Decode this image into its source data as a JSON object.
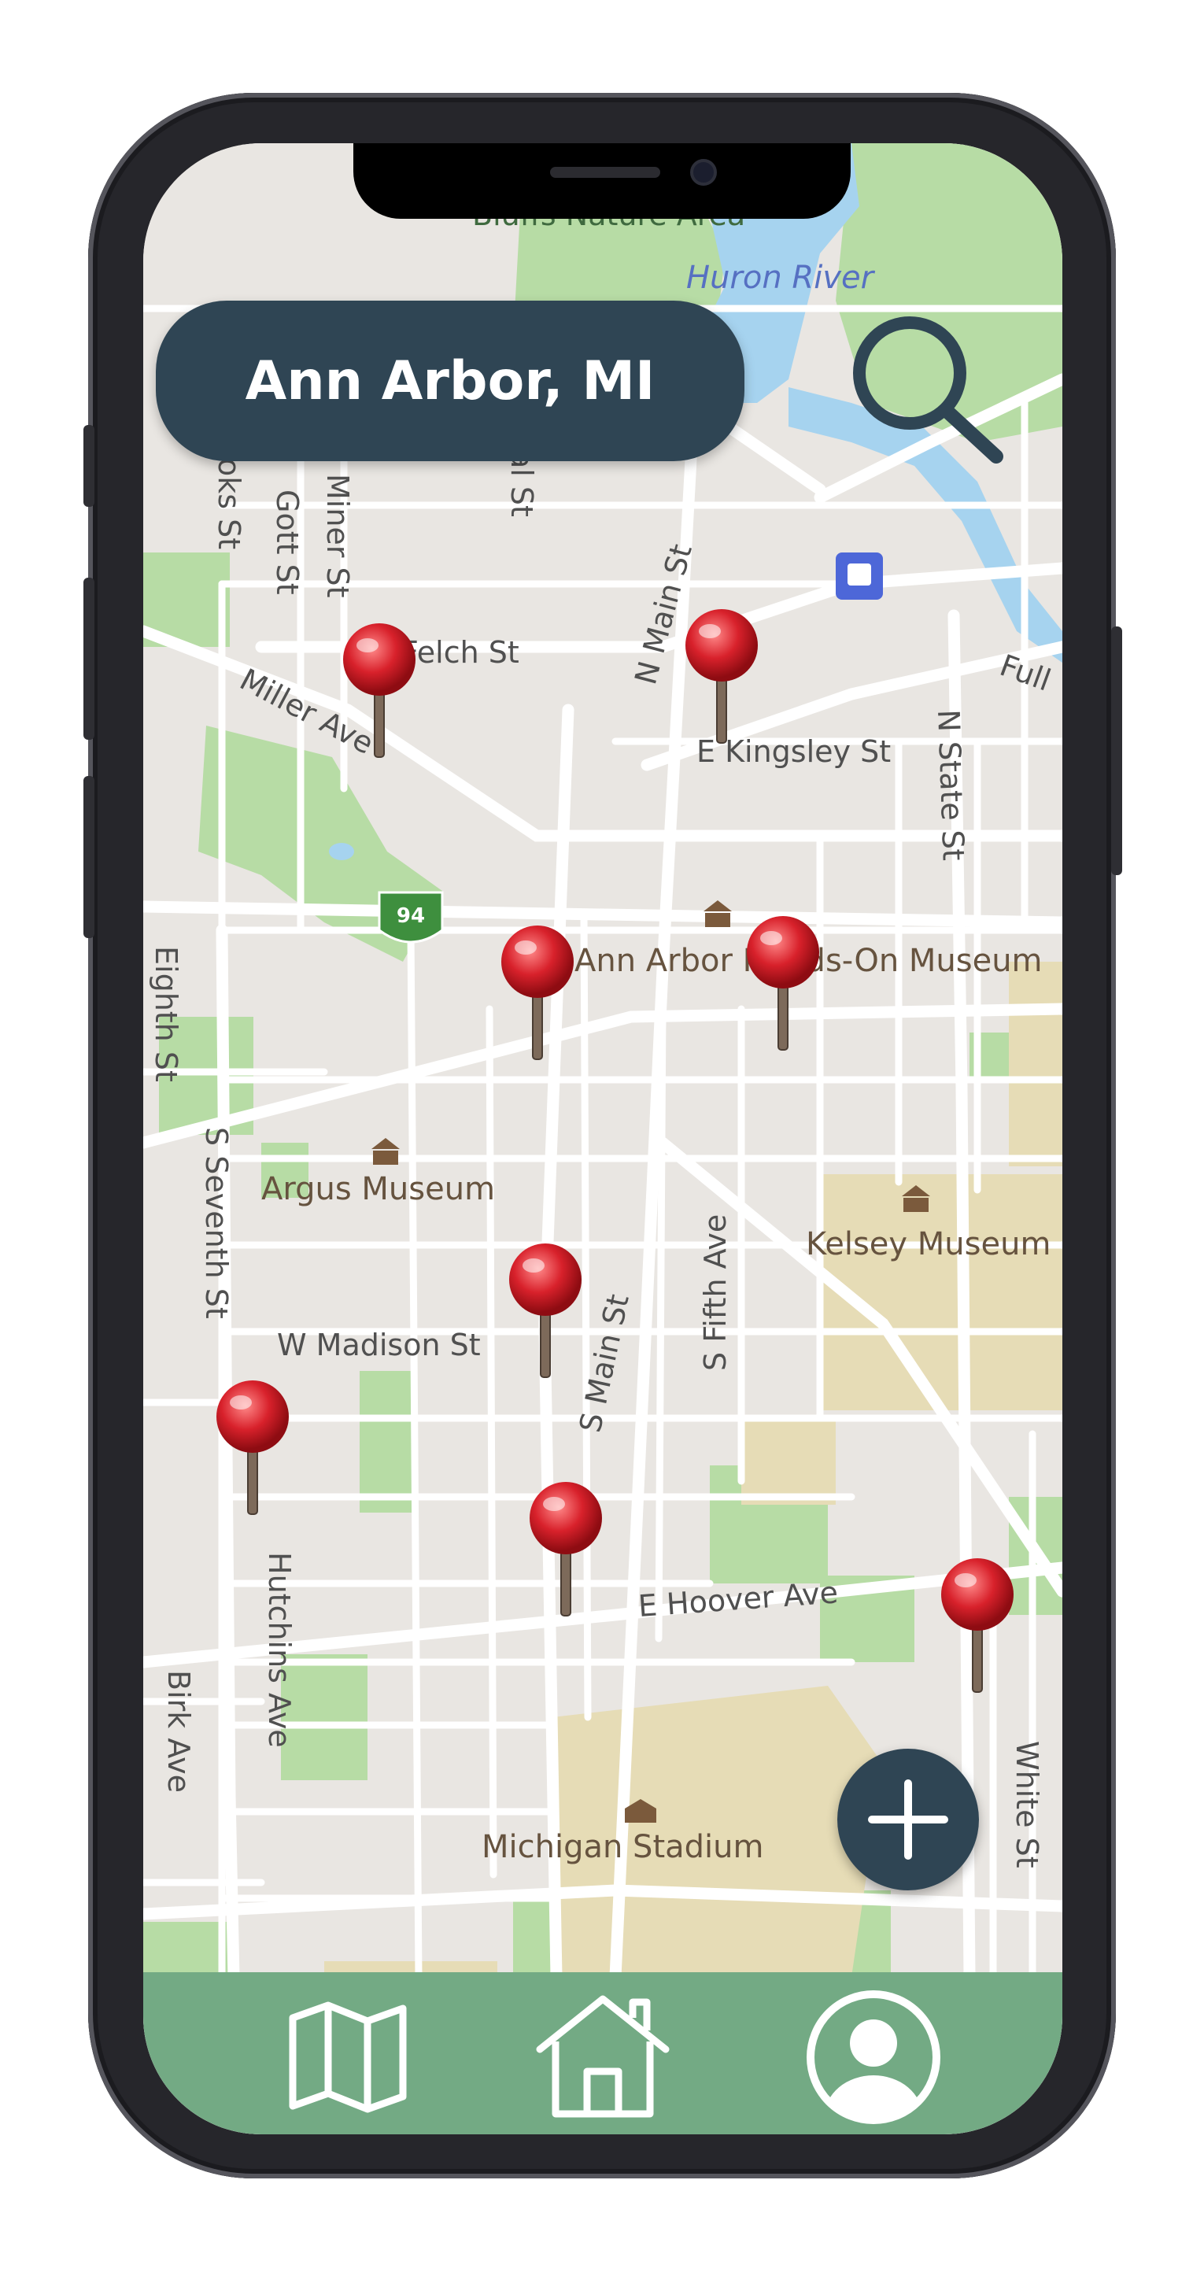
{
  "location": {
    "title": "Ann Arbor, MI"
  },
  "map": {
    "streets": [
      "Felch St",
      "Miller Ave",
      "E Kingsley St",
      "N Main St",
      "N State St",
      "Eighth St",
      "S Seventh St",
      "W Madison St",
      "S Main St",
      "S Fifth Ave",
      "Hutchins Ave",
      "E Hoover Ave",
      "Birk Ave",
      "White St",
      "Gott St",
      "Miner St",
      "oks St",
      "Full",
      "St",
      "al St"
    ],
    "places": [
      "Bluffs Nature Area",
      "Huron River",
      "Ann Arbor Hands-On Museum",
      "Argus Museum",
      "Kelsey Museum of Archaeology",
      "Michigan Stadium"
    ],
    "shield": "94",
    "pins_count": 8
  },
  "icons": {
    "search": "search-icon",
    "add": "plus-icon",
    "nav_map": "map-icon",
    "nav_home": "home-icon",
    "nav_profile": "user-icon"
  },
  "colors": {
    "accent": "#2f4554",
    "nav_bar": "#73aa84",
    "pin": "#d8212b",
    "park": "#b7dca5",
    "water": "#a6d3ef",
    "campus": "#e6dcb6"
  }
}
